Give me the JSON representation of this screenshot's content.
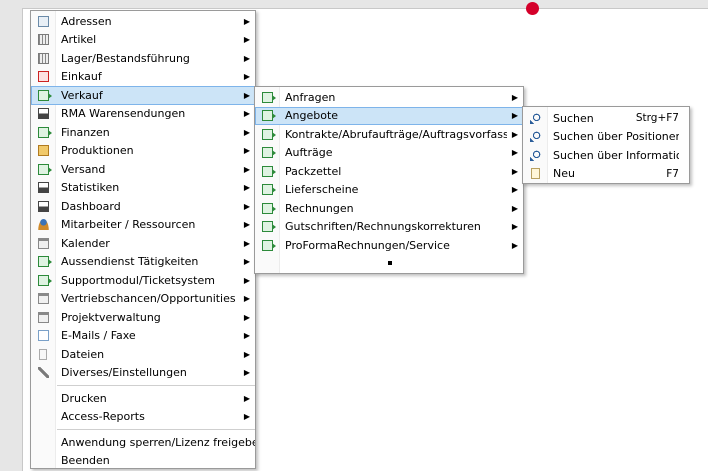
{
  "main_menu": {
    "items": [
      {
        "label": "Adressen",
        "icon": "address-card-icon",
        "arrow": true
      },
      {
        "label": "Artikel",
        "icon": "barcode-icon",
        "arrow": true
      },
      {
        "label": "Lager/Bestandsführung",
        "icon": "warehouse-icon",
        "arrow": true
      },
      {
        "label": "Einkauf",
        "icon": "purchase-icon",
        "arrow": true
      },
      {
        "label": "Verkauf",
        "icon": "sales-document-icon",
        "arrow": true,
        "highlighted": true
      },
      {
        "label": "RMA Warensendungen",
        "icon": "rma-icon",
        "arrow": true
      },
      {
        "label": "Finanzen",
        "icon": "finance-icon",
        "arrow": true
      },
      {
        "label": "Produktionen",
        "icon": "production-box-icon",
        "arrow": true
      },
      {
        "label": "Versand",
        "icon": "shipping-icon",
        "arrow": true
      },
      {
        "label": "Statistiken",
        "icon": "statistics-chart-icon",
        "arrow": true
      },
      {
        "label": "Dashboard",
        "icon": "dashboard-icon",
        "arrow": true
      },
      {
        "label": "Mitarbeiter / Ressourcen",
        "icon": "employee-icon",
        "arrow": true
      },
      {
        "label": "Kalender",
        "icon": "calendar-icon",
        "arrow": true
      },
      {
        "label": "Aussendienst Tätigkeiten",
        "icon": "field-service-icon",
        "arrow": true
      },
      {
        "label": "Supportmodul/Ticketsystem",
        "icon": "support-ticket-icon",
        "arrow": true
      },
      {
        "label": "Vertriebschancen/Opportunities",
        "icon": "opportunities-icon",
        "arrow": true
      },
      {
        "label": "Projektverwaltung",
        "icon": "project-icon",
        "arrow": true
      },
      {
        "label": "E-Mails / Faxe",
        "icon": "mail-icon",
        "arrow": true
      },
      {
        "label": "Dateien",
        "icon": "file-icon",
        "arrow": true
      },
      {
        "label": "Diverses/Einstellungen",
        "icon": "settings-tool-icon",
        "arrow": true
      }
    ],
    "group2": [
      {
        "label": "Drucken",
        "arrow": true
      },
      {
        "label": "Access-Reports",
        "arrow": true
      }
    ],
    "group3": [
      {
        "label": "Anwendung sperren/Lizenz freigeben",
        "arrow": false
      },
      {
        "label": "Beenden",
        "arrow": false
      }
    ]
  },
  "verkauf_menu": {
    "items": [
      {
        "label": "Anfragen",
        "icon": "document-arrow-icon",
        "arrow": true
      },
      {
        "label": "Angebote",
        "icon": "document-arrow-icon",
        "arrow": true,
        "highlighted": true
      },
      {
        "label": "Kontrakte/Abrufaufträge/Auftragsvorfassung",
        "icon": "document-arrow-icon",
        "arrow": true
      },
      {
        "label": "Aufträge",
        "icon": "document-arrow-icon",
        "arrow": true
      },
      {
        "label": "Packzettel",
        "icon": "document-arrow-icon",
        "arrow": true
      },
      {
        "label": "Lieferscheine",
        "icon": "document-arrow-icon",
        "arrow": true
      },
      {
        "label": "Rechnungen",
        "icon": "document-arrow-icon",
        "arrow": true
      },
      {
        "label": "Gutschriften/Rechnungskorrekturen",
        "icon": "document-arrow-icon",
        "arrow": true
      },
      {
        "label": "ProFormaRechnungen/Service",
        "icon": "document-arrow-icon",
        "arrow": true
      }
    ]
  },
  "angebote_menu": {
    "items": [
      {
        "label": "Suchen",
        "icon": "search-icon",
        "shortcut": "Strg+F7"
      },
      {
        "label": "Suchen über Positionen",
        "icon": "search-positions-icon",
        "shortcut": ""
      },
      {
        "label": "Suchen über Informationen",
        "icon": "search-info-icon",
        "shortcut": ""
      },
      {
        "label": "Neu",
        "icon": "new-document-icon",
        "shortcut": "F7"
      }
    ]
  },
  "colors": {
    "highlight": "#cce4f7",
    "highlight_border": "#7eb4ea",
    "notification_dot": "#d4002a",
    "background": "#e6e6e6"
  }
}
